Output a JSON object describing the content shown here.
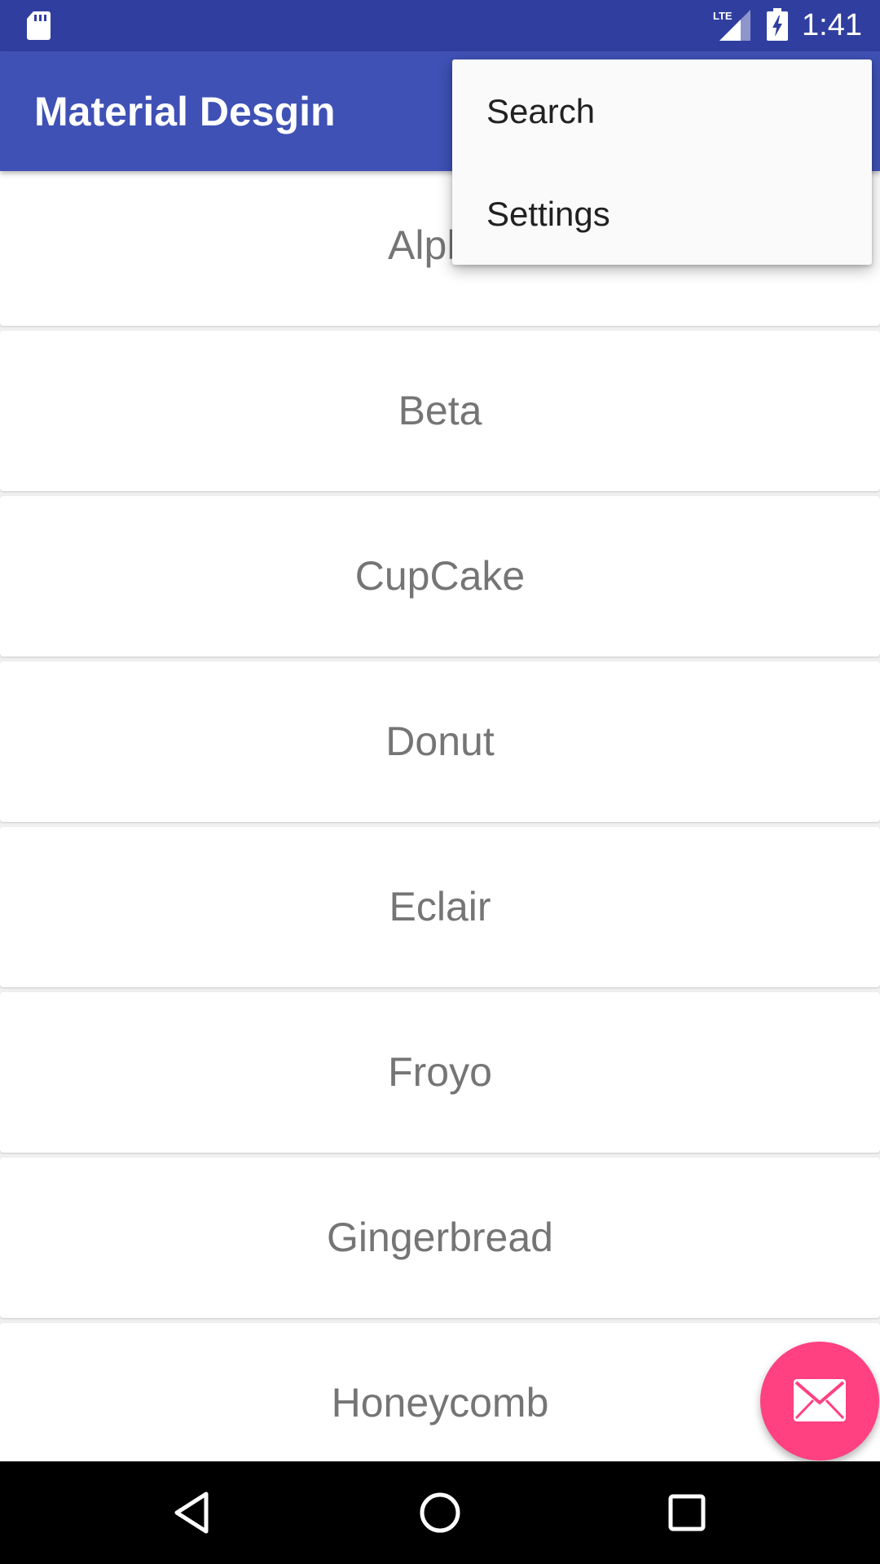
{
  "status_bar": {
    "time": "1:41",
    "network_label": "LTE",
    "icons": [
      "sd-card-icon",
      "lte-signal-icon",
      "battery-charging-icon"
    ]
  },
  "app_bar": {
    "title": "Material Desgin",
    "color": "#3f51b5"
  },
  "overflow_menu": {
    "items": [
      {
        "label": "Search"
      },
      {
        "label": "Settings"
      }
    ]
  },
  "list": {
    "items": [
      {
        "label": "Alpha"
      },
      {
        "label": "Beta"
      },
      {
        "label": "CupCake"
      },
      {
        "label": "Donut"
      },
      {
        "label": "Eclair"
      },
      {
        "label": "Froyo"
      },
      {
        "label": "Gingerbread"
      },
      {
        "label": "Honeycomb"
      }
    ]
  },
  "fab": {
    "icon": "mail-icon",
    "color": "#ff4081"
  },
  "nav_bar": {
    "buttons": [
      "back-icon",
      "home-icon",
      "recents-icon"
    ]
  },
  "colors": {
    "status_bar": "#303f9f",
    "primary": "#3f51b5",
    "accent": "#ff4081",
    "list_text": "#757575"
  }
}
